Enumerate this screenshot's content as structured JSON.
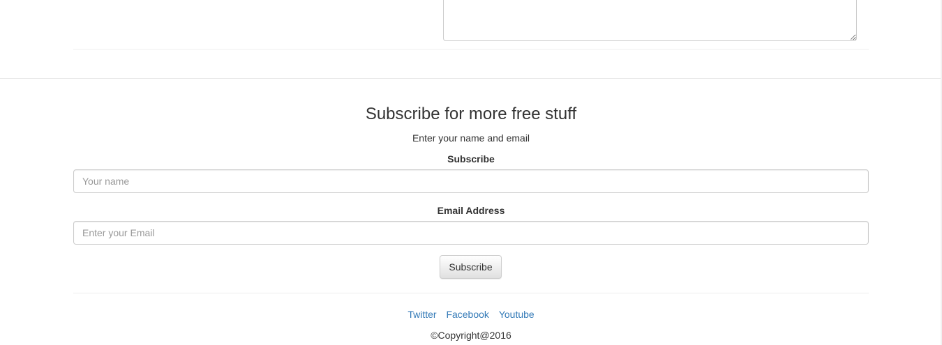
{
  "subscribe": {
    "title": "Subscribe for more free stuff",
    "subtitle": "Enter your name and email",
    "name_label": "Subscribe",
    "name_placeholder": "Your name",
    "name_value": "",
    "email_label": "Email Address",
    "email_placeholder": "Enter your Email",
    "email_value": "",
    "button_label": "Subscribe"
  },
  "footer": {
    "links": [
      {
        "label": "Twitter"
      },
      {
        "label": "Facebook"
      },
      {
        "label": "Youtube"
      }
    ],
    "copyright": "©Copyright@2016"
  },
  "colors": {
    "link": "#337ab7",
    "text": "#333333",
    "placeholder": "#999999",
    "border": "#cccccc",
    "divider": "#eeeeee"
  },
  "icons": {
    "resize_grip": "resize-grip-icon"
  }
}
